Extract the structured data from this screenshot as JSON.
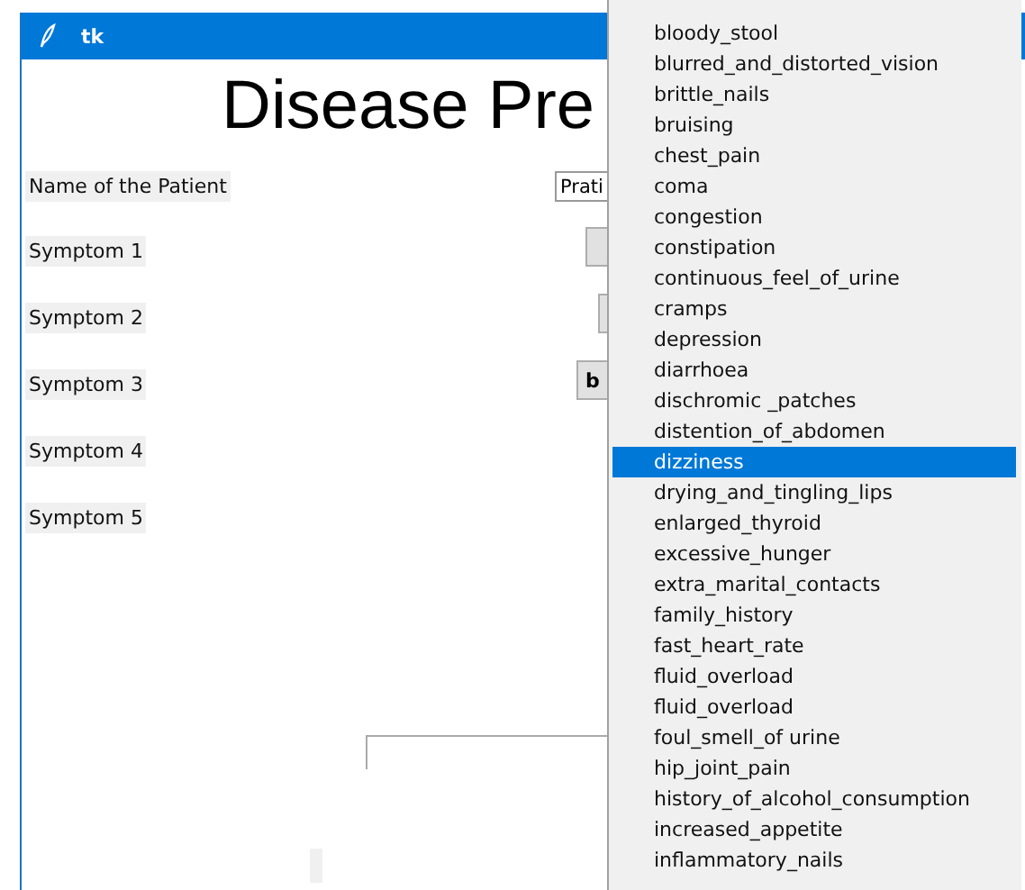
{
  "window": {
    "title": "tk"
  },
  "heading": "Disease Pre",
  "patient": {
    "label": "Name of the Patient",
    "value": "Prati"
  },
  "symptoms": [
    {
      "label": "Symptom 1"
    },
    {
      "label": "Symptom 2"
    },
    {
      "label": "Symptom 3",
      "button": "b"
    },
    {
      "label": "Symptom 4"
    },
    {
      "label": "Symptom 5"
    }
  ],
  "dropdown": {
    "items": [
      {
        "label": "bloody_stool",
        "selected": false
      },
      {
        "label": "blurred_and_distorted_vision",
        "selected": false
      },
      {
        "label": "brittle_nails",
        "selected": false
      },
      {
        "label": "bruising",
        "selected": false
      },
      {
        "label": "chest_pain",
        "selected": false
      },
      {
        "label": "coma",
        "selected": false
      },
      {
        "label": "congestion",
        "selected": false
      },
      {
        "label": "constipation",
        "selected": false
      },
      {
        "label": "continuous_feel_of_urine",
        "selected": false
      },
      {
        "label": "cramps",
        "selected": false
      },
      {
        "label": "depression",
        "selected": false
      },
      {
        "label": "diarrhoea",
        "selected": false
      },
      {
        "label": "dischromic _patches",
        "selected": false
      },
      {
        "label": "distention_of_abdomen",
        "selected": false
      },
      {
        "label": "dizziness",
        "selected": true
      },
      {
        "label": "drying_and_tingling_lips",
        "selected": false
      },
      {
        "label": "enlarged_thyroid",
        "selected": false
      },
      {
        "label": "excessive_hunger",
        "selected": false
      },
      {
        "label": "extra_marital_contacts",
        "selected": false
      },
      {
        "label": "family_history",
        "selected": false
      },
      {
        "label": "fast_heart_rate",
        "selected": false
      },
      {
        "label": "fluid_overload",
        "selected": false
      },
      {
        "label": "fluid_overload",
        "selected": false
      },
      {
        "label": "foul_smell_of urine",
        "selected": false
      },
      {
        "label": "hip_joint_pain",
        "selected": false
      },
      {
        "label": "history_of_alcohol_consumption",
        "selected": false
      },
      {
        "label": "increased_appetite",
        "selected": false
      },
      {
        "label": "inflammatory_nails",
        "selected": false
      }
    ]
  }
}
